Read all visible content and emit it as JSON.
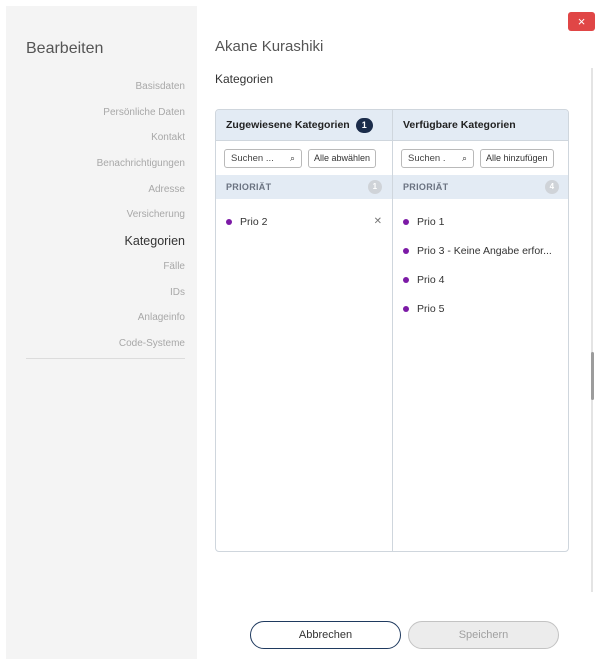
{
  "sidebar": {
    "title": "Bearbeiten",
    "items": [
      {
        "label": "Basisdaten"
      },
      {
        "label": "Persönliche Daten"
      },
      {
        "label": "Kontakt"
      },
      {
        "label": "Benachrichtigungen"
      },
      {
        "label": "Adresse"
      },
      {
        "label": "Versicherung"
      },
      {
        "label": "Kategorien"
      },
      {
        "label": "Fälle"
      },
      {
        "label": "IDs"
      },
      {
        "label": "Anlageinfo"
      },
      {
        "label": "Code-Systeme"
      }
    ],
    "active_index": 6
  },
  "dialog": {
    "close_label": "×",
    "person_name": "Akane Kurashiki",
    "section_title": "Kategorien"
  },
  "assigned": {
    "title": "Zugewiesene Kategorien",
    "count": "1",
    "search_placeholder": "Suchen ...",
    "action_label": "Alle abwählen",
    "group_label": "PRIORIÄT",
    "group_count": "1",
    "items": [
      {
        "label": "Prio 2"
      }
    ]
  },
  "available": {
    "title": "Verfügbare Kategorien",
    "search_placeholder": "Suchen .",
    "action_label": "Alle hinzufügen",
    "group_label": "PRIORIÄT",
    "group_count": "4",
    "items": [
      {
        "label": "Prio 1"
      },
      {
        "label": "Prio 3 - Keine Angabe erfor..."
      },
      {
        "label": "Prio 4"
      },
      {
        "label": "Prio 5"
      }
    ]
  },
  "footer": {
    "cancel_label": "Abbrechen",
    "save_label": "Speichern"
  },
  "colors": {
    "accent": "#1b2c4a",
    "close": "#e04646",
    "item_dot": "#7c1aa6",
    "header_bg": "#e3ebf4"
  },
  "icons": {
    "close": "close-icon",
    "search": "search-icon",
    "remove": "remove-icon"
  }
}
